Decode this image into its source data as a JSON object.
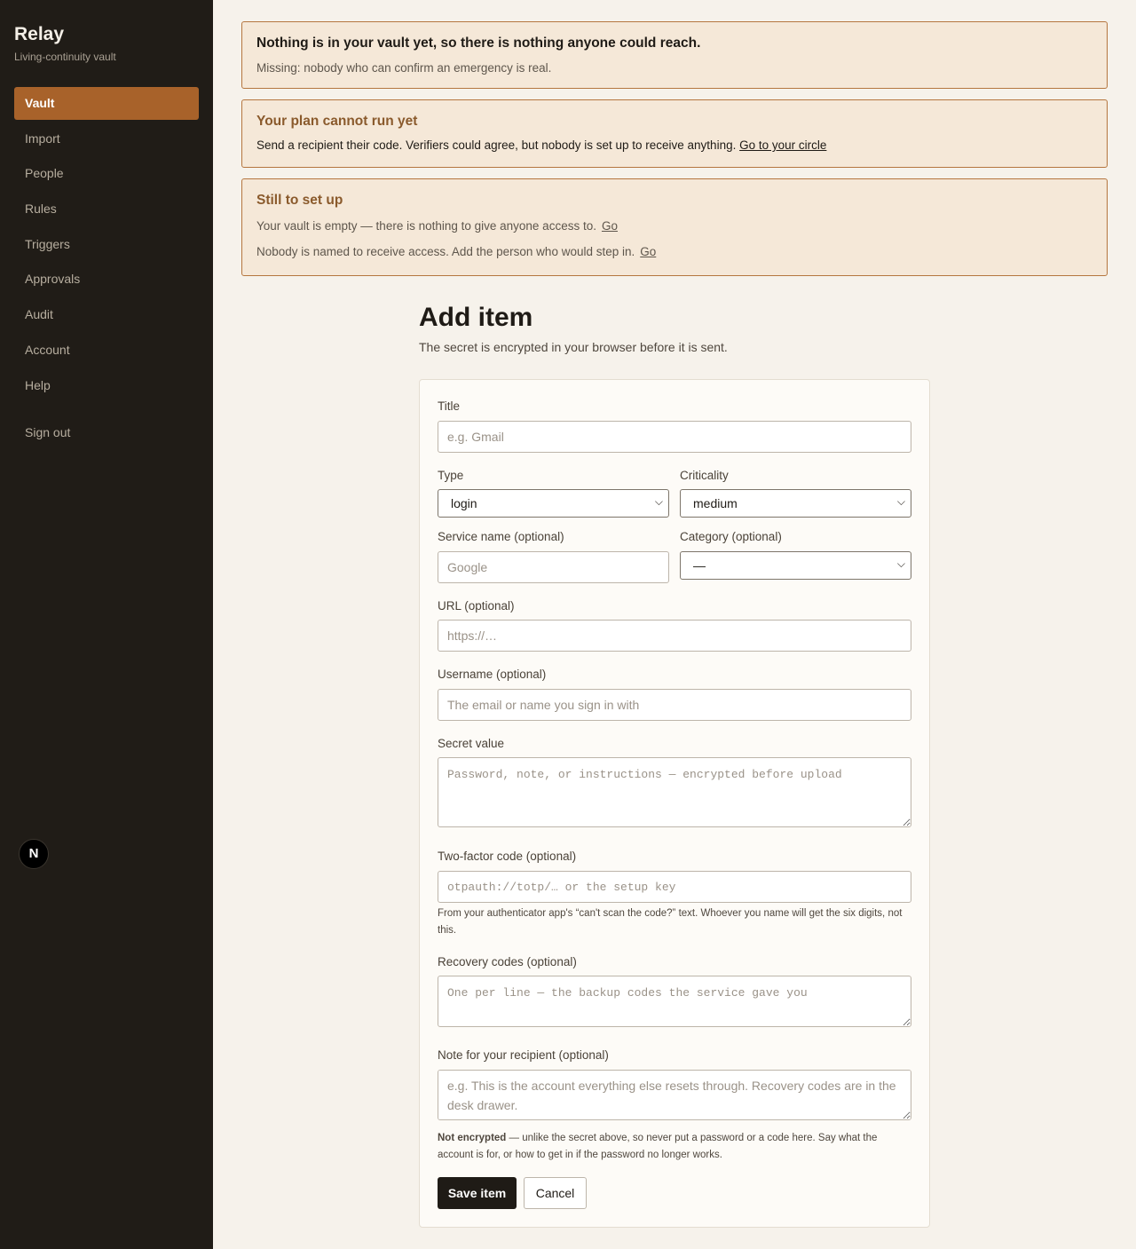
{
  "sidebar": {
    "brand": "Relay",
    "tagline": "Living-continuity vault",
    "items": [
      {
        "label": "Vault"
      },
      {
        "label": "Import"
      },
      {
        "label": "People"
      },
      {
        "label": "Rules"
      },
      {
        "label": "Triggers"
      },
      {
        "label": "Approvals"
      },
      {
        "label": "Audit"
      },
      {
        "label": "Account"
      },
      {
        "label": "Help"
      }
    ],
    "active": "Vault",
    "signout": "Sign out",
    "badge": "N"
  },
  "banners": {
    "vault_empty": {
      "title": "Nothing is in your vault yet, so there is nothing anyone could reach.",
      "detail": "Missing: nobody who can confirm an emergency is real."
    },
    "plan": {
      "title": "Your plan cannot run yet",
      "detail": "Send a recipient their code. Verifiers could agree, but nobody is set up to receive anything.",
      "link": "Go to your circle"
    },
    "setup": {
      "title": "Still to set up",
      "items": [
        {
          "text": "Your vault is empty — there is nothing to give anyone access to.",
          "link": "Go"
        },
        {
          "text": "Nobody is named to receive access. Add the person who would step in.",
          "link": "Go"
        }
      ]
    }
  },
  "page": {
    "title": "Add item",
    "subtitle": "The secret is encrypted in your browser before it is sent."
  },
  "form": {
    "title": {
      "label": "Title",
      "placeholder": "e.g. Gmail",
      "value": ""
    },
    "type": {
      "label": "Type",
      "selected": "login"
    },
    "criticality": {
      "label": "Criticality",
      "selected": "medium"
    },
    "service": {
      "label": "Service name (optional)",
      "placeholder": "Google",
      "value": ""
    },
    "category": {
      "label": "Category (optional)",
      "selected": "—"
    },
    "url": {
      "label": "URL (optional)",
      "placeholder": "https://…",
      "value": ""
    },
    "username": {
      "label": "Username (optional)",
      "placeholder": "The email or name you sign in with",
      "value": ""
    },
    "secret": {
      "label": "Secret value",
      "placeholder": "Password, note, or instructions — encrypted before upload",
      "value": ""
    },
    "twofactor": {
      "label": "Two-factor code (optional)",
      "placeholder": "otpauth://totp/… or the setup key",
      "help": "From your authenticator app's “can't scan the code?” text. Whoever you name will get the six digits, not this."
    },
    "recovery": {
      "label": "Recovery codes (optional)",
      "placeholder": "One per line — the backup codes the service gave you"
    },
    "note": {
      "label": "Note for your recipient (optional)",
      "placeholder": "e.g. This is the account everything else resets through. Recovery codes are in the desk drawer.",
      "help_strong": "Not encrypted",
      "help_rest": " — unlike the secret above, so never put a password or a code here. Say what the account is for, or how to get in if the password no longer works."
    },
    "save_label": "Save item",
    "cancel_label": "Cancel"
  }
}
